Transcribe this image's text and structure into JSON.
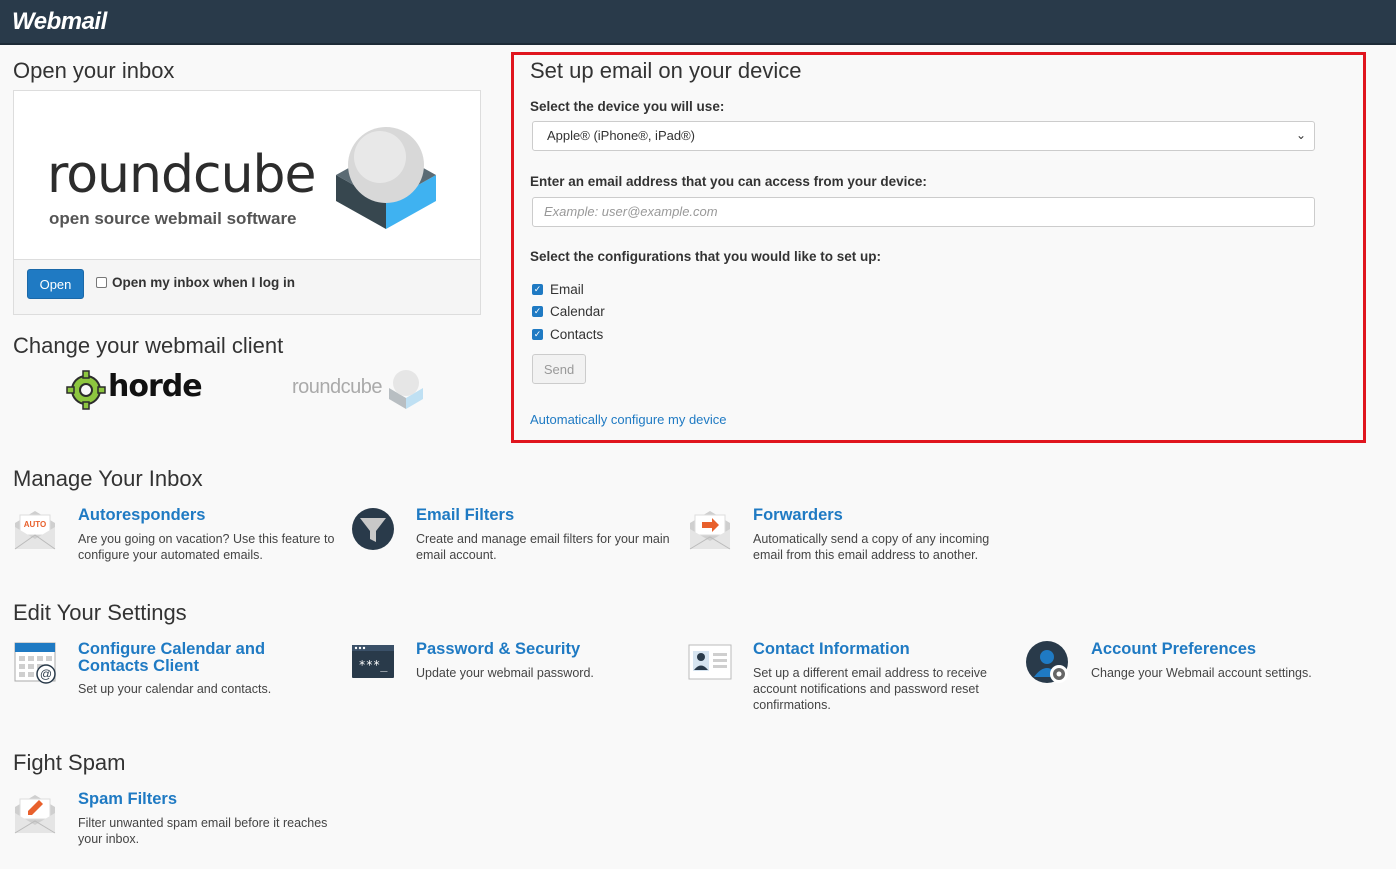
{
  "header": {
    "brand": "Webmail"
  },
  "open_inbox": {
    "heading": "Open your inbox",
    "logo_word": "roundcube",
    "logo_tagline": "open source webmail software",
    "open_button": "Open",
    "auto_open_label": "Open my inbox when I log in"
  },
  "change_client": {
    "heading": "Change your webmail client",
    "clients": [
      "horde",
      "roundcube"
    ]
  },
  "setup_device": {
    "heading": "Set up email on your device",
    "device_label": "Select the device you will use:",
    "device_value": "Apple® (iPhone®, iPad®)",
    "email_label": "Enter an email address that you can access from your device:",
    "email_placeholder": "Example: user@example.com",
    "config_label": "Select the configurations that you would like to set up:",
    "configs": [
      "Email",
      "Calendar",
      "Contacts"
    ],
    "send_button": "Send",
    "auto_link": "Automatically configure my device"
  },
  "manage_inbox": {
    "heading": "Manage Your Inbox",
    "items": [
      {
        "title": "Autoresponders",
        "desc": "Are you going on vacation? Use this feature to configure your automated emails.",
        "icon": "autoresponder-icon",
        "badge": "AUTO"
      },
      {
        "title": "Email Filters",
        "desc": "Create and manage email filters for your main email account.",
        "icon": "filter-icon"
      },
      {
        "title": "Forwarders",
        "desc": "Automatically send a copy of any incoming email from this email address to another.",
        "icon": "forwarder-icon"
      }
    ]
  },
  "edit_settings": {
    "heading": "Edit Your Settings",
    "items": [
      {
        "title": "Configure Calendar and Contacts Client",
        "desc": "Set up your calendar and contacts.",
        "icon": "calendar-icon"
      },
      {
        "title": "Password & Security",
        "desc": "Update your webmail password.",
        "icon": "password-icon",
        "mask": "***_"
      },
      {
        "title": "Contact Information",
        "desc": "Set up a different email address to receive account notifications and password reset confirmations.",
        "icon": "contact-card-icon"
      },
      {
        "title": "Account Preferences",
        "desc": "Change your Webmail account settings.",
        "icon": "account-prefs-icon"
      }
    ]
  },
  "fight_spam": {
    "heading": "Fight Spam",
    "items": [
      {
        "title": "Spam Filters",
        "desc": "Filter unwanted spam email before it reaches your inbox.",
        "icon": "spam-filter-icon"
      }
    ]
  },
  "colors": {
    "topbar": "#293a4a",
    "link": "#1f7ac3",
    "highlight": "#e0151e",
    "primary_button": "#1f7ac3"
  }
}
